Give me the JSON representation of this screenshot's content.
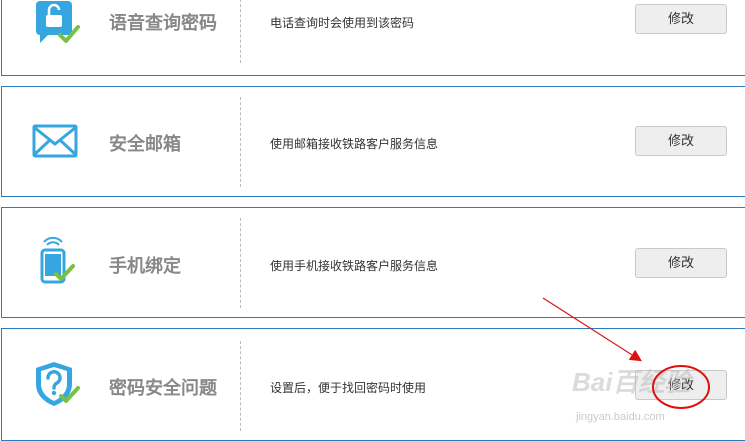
{
  "colors": {
    "accent": "#2b7bbd",
    "icon": "#36a6e0",
    "check": "#7ac143",
    "annotation": "#e01010"
  },
  "items": [
    {
      "icon": "lock-phone-icon",
      "title": "语音查询密码",
      "desc": "电话查询时会使用到该密码",
      "button": "修改"
    },
    {
      "icon": "envelope-icon",
      "title": "安全邮箱",
      "desc": "使用邮箱接收铁路客户服务信息",
      "button": "修改"
    },
    {
      "icon": "mobile-phone-icon",
      "title": "手机绑定",
      "desc": "使用手机接收铁路客户服务信息",
      "button": "修改"
    },
    {
      "icon": "shield-question-icon",
      "title": "密码安全问题",
      "desc": "设置后，便于找回密码时使用",
      "button": "修改"
    }
  ],
  "watermark": {
    "brand": "Bai百经验",
    "url": "jingyan.baidu.com"
  }
}
